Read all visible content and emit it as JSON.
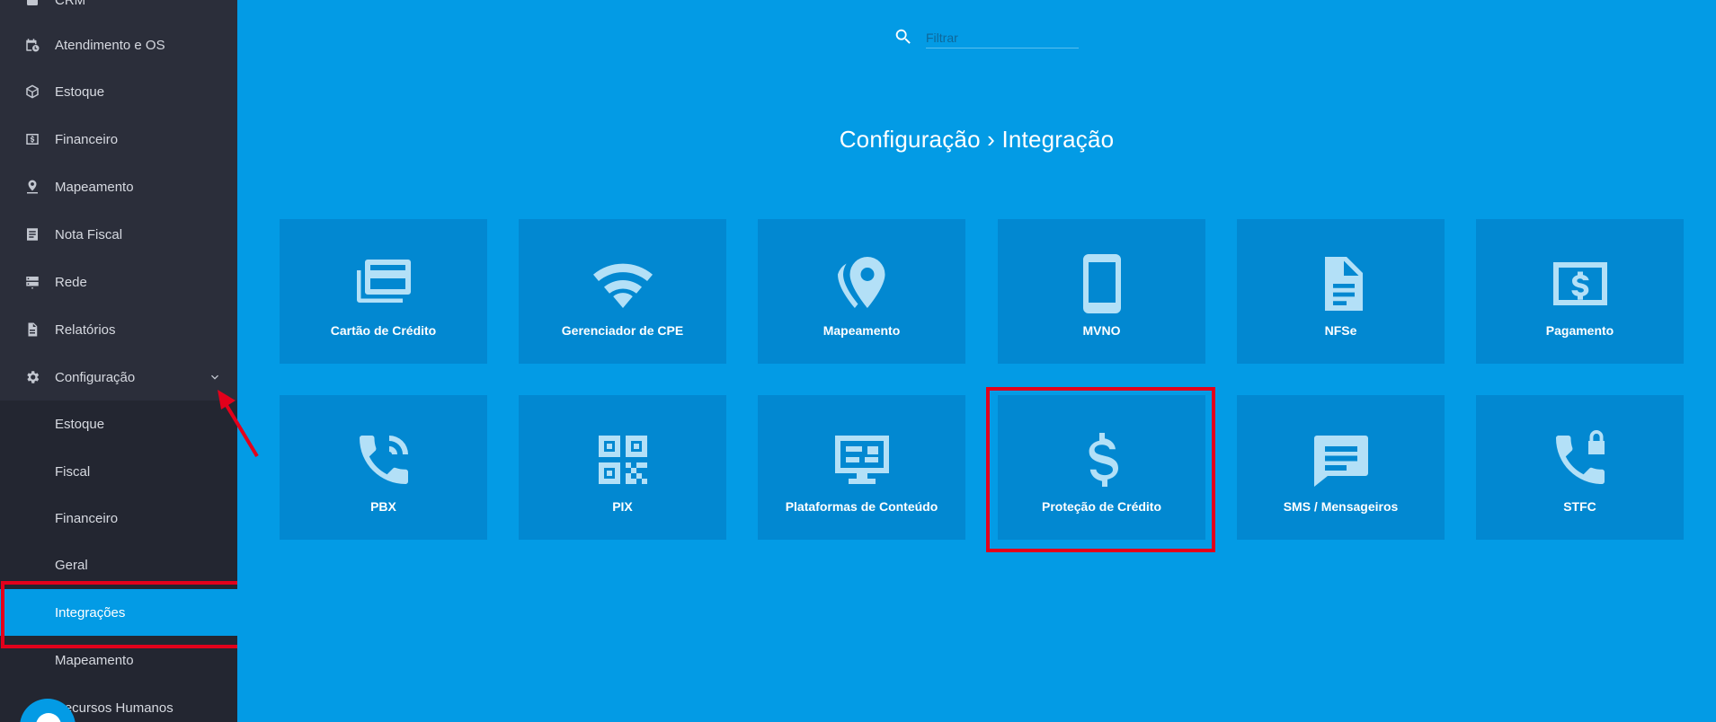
{
  "sidebar": {
    "items": [
      {
        "label": "CRM",
        "icon": "crm-icon"
      },
      {
        "label": "Atendimento e OS",
        "icon": "calendar-clock-icon"
      },
      {
        "label": "Estoque",
        "icon": "cube-icon"
      },
      {
        "label": "Financeiro",
        "icon": "money-icon"
      },
      {
        "label": "Mapeamento",
        "icon": "map-pin-icon"
      },
      {
        "label": "Nota Fiscal",
        "icon": "document-icon"
      },
      {
        "label": "Rede",
        "icon": "server-icon"
      },
      {
        "label": "Relatórios",
        "icon": "report-icon"
      },
      {
        "label": "Configuração",
        "icon": "gear-icon",
        "expanded": true
      }
    ],
    "subitems": [
      {
        "label": "Estoque"
      },
      {
        "label": "Fiscal"
      },
      {
        "label": "Financeiro"
      },
      {
        "label": "Geral"
      },
      {
        "label": "Integrações",
        "active": true
      },
      {
        "label": "Mapeamento"
      },
      {
        "label": "Recursos Humanos"
      }
    ]
  },
  "search": {
    "placeholder": "Filtrar"
  },
  "breadcrumb": "Configuração › Integração",
  "tiles": [
    {
      "label": "Cartão de Crédito",
      "icon": "credit-card-icon"
    },
    {
      "label": "Gerenciador de CPE",
      "icon": "wifi-icon"
    },
    {
      "label": "Mapeamento",
      "icon": "map-marker-icon"
    },
    {
      "label": "MVNO",
      "icon": "phone-device-icon"
    },
    {
      "label": "NFSe",
      "icon": "file-icon"
    },
    {
      "label": "Pagamento",
      "icon": "money-bill-icon"
    },
    {
      "label": "PBX",
      "icon": "phone-ringing-icon"
    },
    {
      "label": "PIX",
      "icon": "qr-code-icon"
    },
    {
      "label": "Plataformas de Conteúdo",
      "icon": "monitor-dashboard-icon"
    },
    {
      "label": "Proteção de Crédito",
      "icon": "dollar-icon"
    },
    {
      "label": "SMS / Mensageiros",
      "icon": "message-icon"
    },
    {
      "label": "STFC",
      "icon": "phone-lock-icon"
    }
  ],
  "colors": {
    "background": "#039be5",
    "tile": "#0288d1",
    "sidebar": "#2b2e3a",
    "highlight": "#e3001b"
  }
}
